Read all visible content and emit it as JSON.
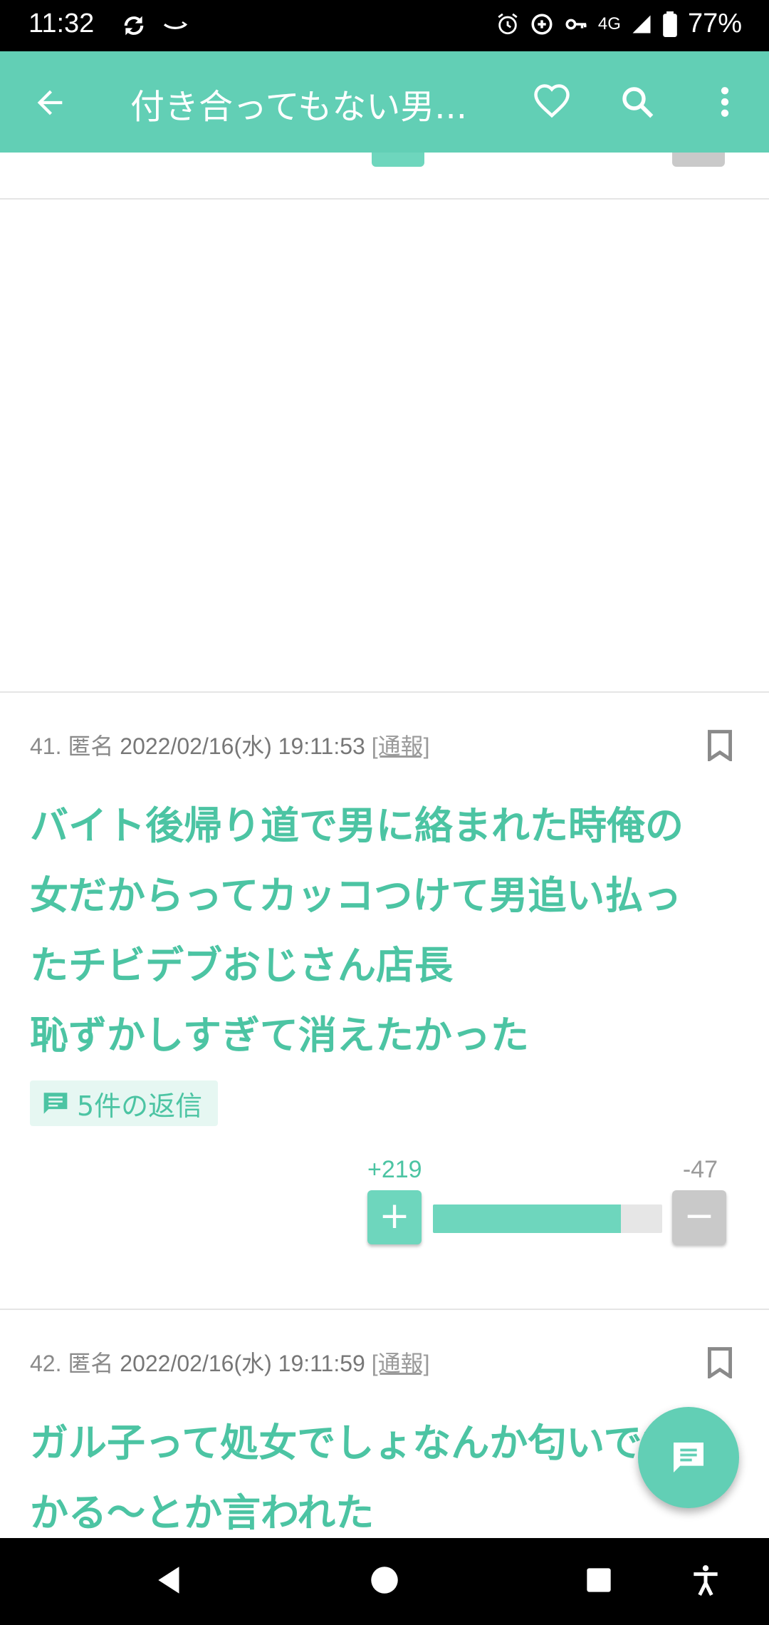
{
  "status_bar": {
    "time": "11:32",
    "network": "4G",
    "battery": "77%"
  },
  "app_bar": {
    "title": "付き合ってもない男..."
  },
  "comments": [
    {
      "meta": {
        "number": "41.",
        "author": "匿名",
        "date": "2022/02/16(水) 19:11:53",
        "report": "[通報]"
      },
      "body": [
        "バイト後帰り道で男に絡まれた時俺の",
        "女だからってカッコつけて男追い払っ",
        "たチビデブおじさん店長",
        "恥ずかしすぎて消えたかった"
      ],
      "replies_label": "5件の返信",
      "votes": {
        "plus": "+219",
        "minus": "-47",
        "plus_ratio": 0.82
      }
    },
    {
      "meta": {
        "number": "42.",
        "author": "匿名",
        "date": "2022/02/16(水) 19:11:59",
        "report": "[通報]"
      },
      "body": [
        "ガル子って処女でしょなんか匂いでわ",
        "かる〜とか言われた"
      ]
    }
  ],
  "colors": {
    "accent": "#62cfb5",
    "text_accent": "#4cc4a3",
    "minus": "#c9c9c9"
  }
}
